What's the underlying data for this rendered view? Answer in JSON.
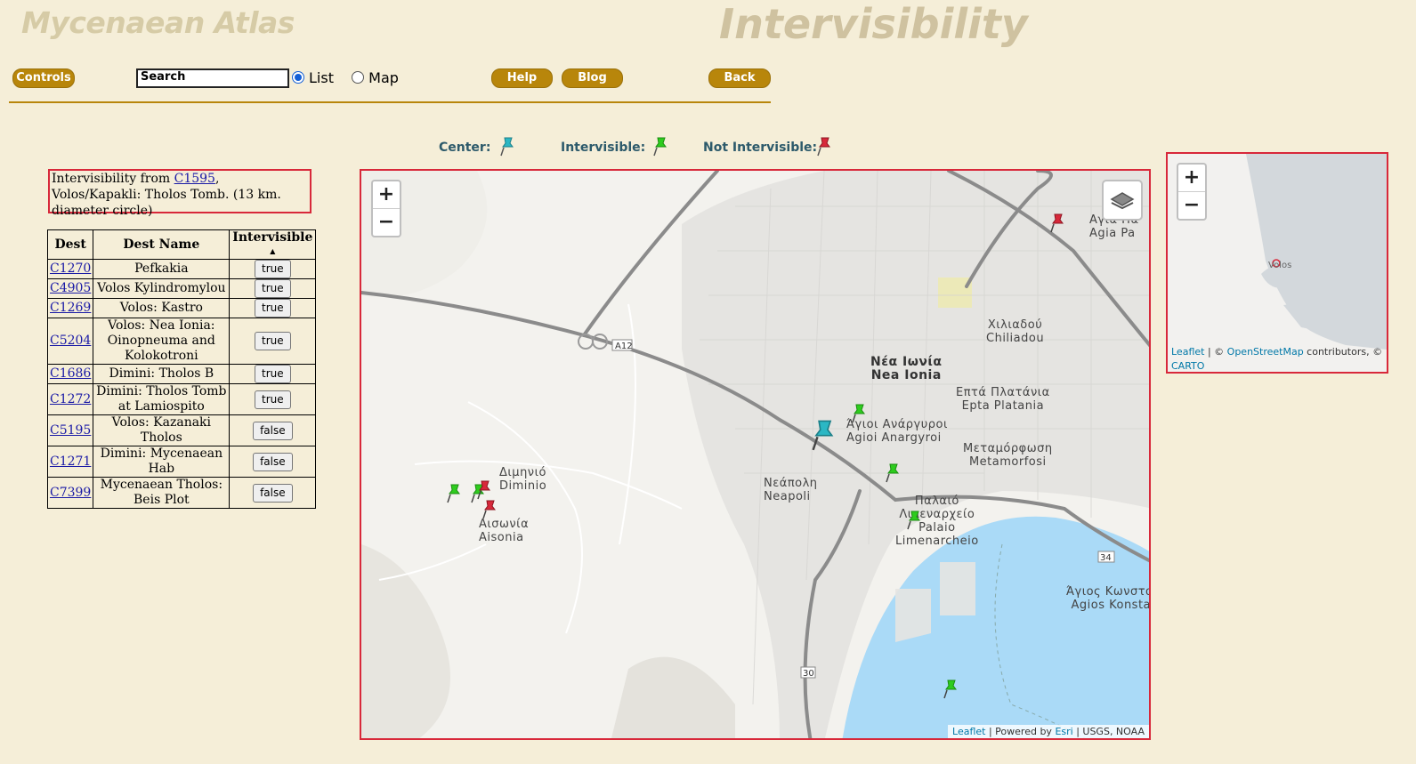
{
  "header": {
    "site_title": "Mycenaean Atlas",
    "page_title": "Intervisibility"
  },
  "toolbar": {
    "controls_label": "Controls",
    "search_value": "Search",
    "view_options": [
      "List",
      "Map"
    ],
    "view_selected": "List",
    "help_label": "Help",
    "blog_label": "Blog",
    "back_label": "Back"
  },
  "legend": {
    "center_label": "Center:",
    "intervisible_label": "Intervisible:",
    "not_intervisible_label": "Not Intervisible:",
    "center_color": "#2bb7c4",
    "intervisible_color": "#2ecc1e",
    "not_intervisible_color": "#d8283a"
  },
  "info": {
    "prefix": "Intervisibility from ",
    "site_code": "C1595",
    "rest": ", Volos/Kapakli: Tholos Tomb.    (13 km. diameter circle)"
  },
  "table": {
    "headers": [
      "Dest",
      "Dest Name",
      "Intervisible"
    ],
    "sort_indicator": "▲",
    "rows": [
      {
        "code": "C1270",
        "name": "Pefkakia",
        "intervisible": "true"
      },
      {
        "code": "C4905",
        "name": "Volos Kylindromylou",
        "intervisible": "true"
      },
      {
        "code": "C1269",
        "name": "Volos: Kastro",
        "intervisible": "true"
      },
      {
        "code": "C5204",
        "name": "Volos: Nea Ionia: Oinopneuma and Kolokotroni",
        "intervisible": "true"
      },
      {
        "code": "C1686",
        "name": "Dimini: Tholos B",
        "intervisible": "true"
      },
      {
        "code": "C1272",
        "name": "Dimini: Tholos Tomb at Lamiospito",
        "intervisible": "true"
      },
      {
        "code": "C5195",
        "name": "Volos: Kazanaki Tholos",
        "intervisible": "false"
      },
      {
        "code": "C1271",
        "name": "Dimini: Mycenaean Hab",
        "intervisible": "false"
      },
      {
        "code": "C7399",
        "name": "Mycenaean Tholos: Beis Plot",
        "intervisible": "false"
      }
    ]
  },
  "map": {
    "zoom_in": "+",
    "zoom_out": "−",
    "labels": {
      "nea_ionia_gr": "Νέα Ιωνία",
      "nea_ionia": "Nea Ionia",
      "agioi_gr": "Άγιοι Ανάργυροι",
      "agioi": "Agioi Anargyroi",
      "neapoli_gr": "Νεάπολη",
      "neapoli": "Neapoli",
      "dimini_gr": "Διμηνιό",
      "dimini": "Diminio",
      "aisonia_gr": "Αισωνία",
      "aisonia": "Aisonia",
      "metamorfosi_gr": "Μεταμόρφωση",
      "metamorfosi": "Metamorfosi",
      "epta_gr": "Επτά Πλατάνια",
      "epta": "Epta Platania",
      "chiliadou_gr": "Χιλιαδού",
      "chiliadou": "Chiliadou",
      "palaio_gr": "Παλαιό",
      "palaio_gr2": "Λιμεναρχείο",
      "palaio": "Palaio",
      "palaio2": "Limenarcheio",
      "agios_gr": "Άγιος Κωνσταντίνος",
      "agios": "Agios Konstantinos",
      "agia_gr": "Αγία Πα",
      "agia": "Agia Pa",
      "road_a12": "A12",
      "road_30": "30",
      "road_34": "34"
    },
    "attribution": {
      "leaflet": "Leaflet",
      "powered": " | Powered by ",
      "esri": "Esri",
      "rest": " | USGS, NOAA"
    }
  },
  "minimap": {
    "zoom_in": "+",
    "zoom_out": "−",
    "place": "Volos",
    "attribution_leaflet": "Leaflet",
    "attribution_mid": " | © ",
    "attribution_osm": "OpenStreetMap",
    "attribution_tail": " contributors, ©",
    "attribution_carto": "CARTO"
  }
}
